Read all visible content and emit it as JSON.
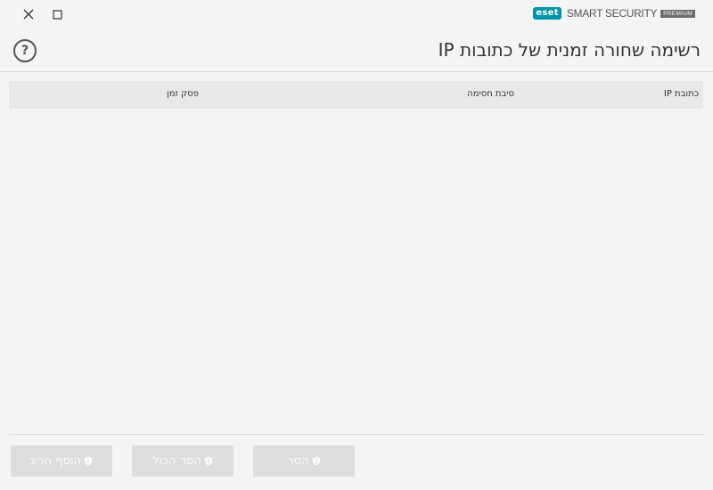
{
  "window": {
    "brand": "eset",
    "product": "SMART SECURITY",
    "edition": "PREMIUM"
  },
  "help": {
    "label": "?"
  },
  "page": {
    "title": "רשימה שחורה זמנית של כתובות IP"
  },
  "table": {
    "columns": [
      "כתובת IP",
      "סיבת חסימה",
      "פסק זמן"
    ],
    "rows": []
  },
  "buttons": {
    "remove": "הסר",
    "remove_all": "הסר הכול",
    "add_exception": "הוסף חריג"
  },
  "colors": {
    "background": "#f4f4f4",
    "header_bg": "#e8e8e8",
    "button_disabled": "#dddddd",
    "brand_accent": "#0094a8"
  },
  "icons": {
    "close": "close-icon",
    "maximize": "maximize-icon",
    "help": "question-icon",
    "button_icon": "shield-icon"
  }
}
